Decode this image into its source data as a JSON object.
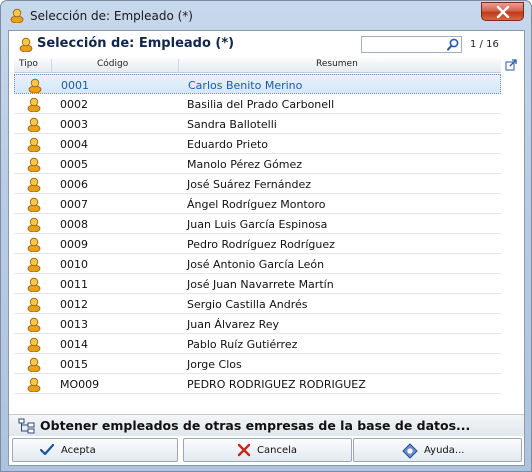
{
  "window": {
    "title": "Selección de: Empleado (*)"
  },
  "header": {
    "title": "Selección de: Empleado (*)",
    "search": {
      "value": "",
      "placeholder": ""
    },
    "pager": "1 / 16"
  },
  "grid": {
    "columns": [
      "Tipo",
      "Código",
      "Resumen"
    ],
    "rows": [
      {
        "code": "0001",
        "name": "Carlos Benito Merino",
        "selected": true
      },
      {
        "code": "0002",
        "name": "Basilia del Prado Carbonell"
      },
      {
        "code": "0003",
        "name": "Sandra Ballotelli"
      },
      {
        "code": "0004",
        "name": "Eduardo Prieto"
      },
      {
        "code": "0005",
        "name": "Manolo Pérez Gómez"
      },
      {
        "code": "0006",
        "name": "José Suárez Fernández"
      },
      {
        "code": "0007",
        "name": "Ángel Rodríguez Montoro"
      },
      {
        "code": "0008",
        "name": "Juan Luis García Espinosa"
      },
      {
        "code": "0009",
        "name": "Pedro Rodríguez Rodríguez"
      },
      {
        "code": "0010",
        "name": "José Antonio García León"
      },
      {
        "code": "0011",
        "name": "José Juan Navarrete Martín"
      },
      {
        "code": "0012",
        "name": "Sergio Castilla Andrés"
      },
      {
        "code": "0013",
        "name": "Juan Álvarez Rey"
      },
      {
        "code": "0014",
        "name": "Pablo Ruíz Gutiérrez"
      },
      {
        "code": "0015",
        "name": "Jorge Clos"
      },
      {
        "code": "MO009",
        "name": "PEDRO RODRIGUEZ RODRIGUEZ"
      }
    ]
  },
  "footer": {
    "link": "Obtener empleados de otras empresas de la base de datos..."
  },
  "buttons": {
    "accept": "Acepta",
    "cancel": "Cancela",
    "help": "Ayuda..."
  },
  "colors": {
    "accent": "#1e58b5",
    "titlebar": "#b9cce3",
    "close": "#c84a2a"
  }
}
